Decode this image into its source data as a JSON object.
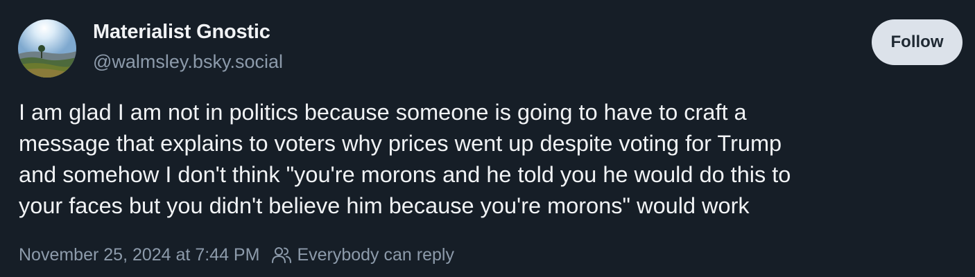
{
  "post": {
    "author": {
      "display_name": "Materialist Gnostic",
      "handle": "@walmsley.bsky.social"
    },
    "follow_label": "Follow",
    "text_lines": [
      "I am glad I am not in politics because someone is going to have to craft a",
      "message that explains to voters why prices went up despite voting for Trump",
      "and somehow I don't think \"you're morons and he told you he would do this to",
      "your faces but you didn't believe him because you're morons\" would work"
    ],
    "timestamp": "November 25, 2024 at 7:44 PM",
    "reply_setting": "Everybody can reply",
    "icons": {
      "reply_setting": "people-icon"
    }
  },
  "colors": {
    "background": "#161e27",
    "primary_text": "#f1f3f5",
    "secondary_text": "#8d9bab",
    "follow_button_bg": "#dce2ea"
  }
}
